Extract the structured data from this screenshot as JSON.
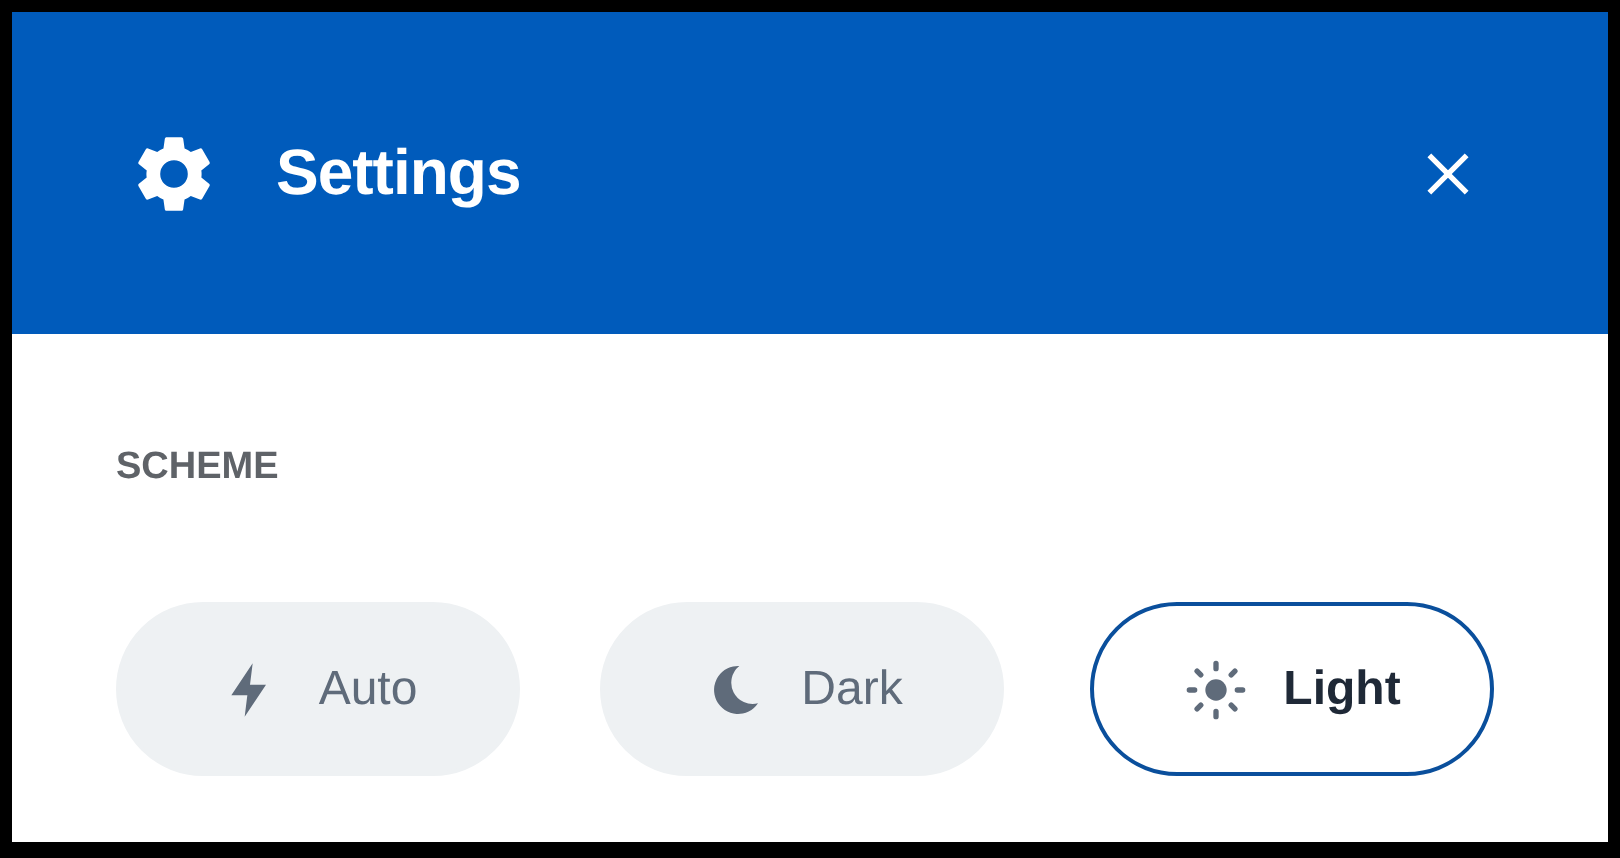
{
  "header": {
    "title": "Settings"
  },
  "section": {
    "label": "SCHEME"
  },
  "options": [
    {
      "kind": "auto",
      "label": "Auto",
      "selected": false
    },
    {
      "kind": "dark",
      "label": "Dark",
      "selected": false
    },
    {
      "kind": "light",
      "label": "Light",
      "selected": true
    }
  ]
}
